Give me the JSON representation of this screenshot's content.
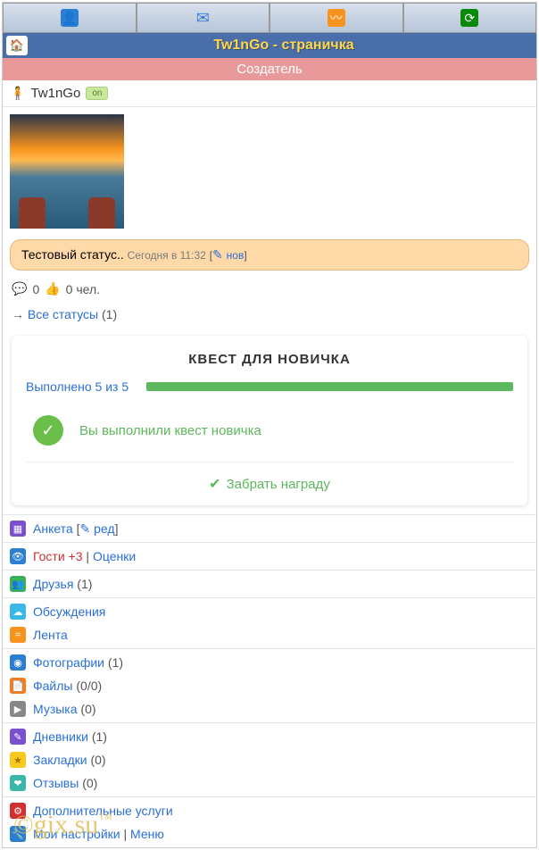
{
  "title": "Tw1nGo - страничка",
  "creator": "Создатель",
  "user": {
    "name": "Tw1nGo",
    "badge": "on"
  },
  "status": {
    "text": "Тестовый статус..",
    "time": "Сегодня в 11:32",
    "nov": "нов",
    "comments": "0",
    "people": "0 чел."
  },
  "allStatuses": {
    "arrow": "→",
    "label": "Все статусы",
    "count": "(1)"
  },
  "quest": {
    "title": "КВЕСТ ДЛЯ НОВИЧКА",
    "progress": "Выполнено 5 из 5",
    "message": "Вы выполнили квест новичка",
    "reward": "Забрать награду"
  },
  "anketa": {
    "label": "Анкета",
    "edit": "ред"
  },
  "guests": {
    "label": "Гости +3",
    "sep": " | ",
    "ratings": "Оценки"
  },
  "friends": {
    "label": "Друзья",
    "count": "(1)"
  },
  "discussions": "Обсуждения",
  "feed": "Лента",
  "photos": {
    "label": "Фотографии",
    "count": "(1)"
  },
  "files": {
    "label": "Файлы",
    "count": "(0/0)"
  },
  "music": {
    "label": "Музыка",
    "count": "(0)"
  },
  "diaries": {
    "label": "Дневники",
    "count": "(1)"
  },
  "bookmarks": {
    "label": "Закладки",
    "count": "(0)"
  },
  "reviews": {
    "label": "Отзывы",
    "count": "(0)"
  },
  "extras": "Дополнительные услуги",
  "settings": {
    "label": "Мои настройки",
    "sep": " | ",
    "menu": "Меню"
  },
  "watermark": "©gix.su",
  "watermark_tm": "™"
}
